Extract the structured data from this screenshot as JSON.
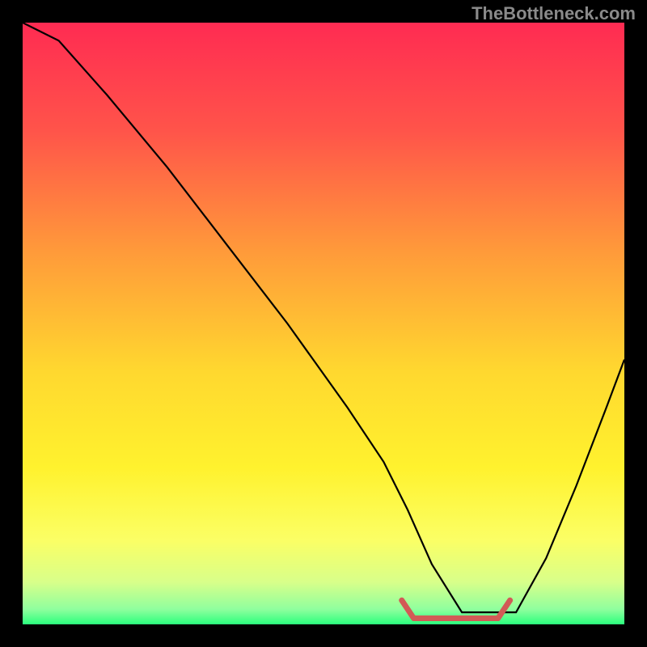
{
  "watermark": "TheBottleneck.com",
  "chart_data": {
    "type": "line",
    "title": "",
    "xlabel": "",
    "ylabel": "",
    "xlim": [
      0,
      100
    ],
    "ylim": [
      0,
      100
    ],
    "background_gradient": {
      "stops": [
        {
          "offset": 0.0,
          "color": "#ff2b52"
        },
        {
          "offset": 0.18,
          "color": "#ff544a"
        },
        {
          "offset": 0.38,
          "color": "#ff9a3a"
        },
        {
          "offset": 0.58,
          "color": "#ffd82f"
        },
        {
          "offset": 0.74,
          "color": "#fff22e"
        },
        {
          "offset": 0.86,
          "color": "#fbff65"
        },
        {
          "offset": 0.93,
          "color": "#d8ff8a"
        },
        {
          "offset": 0.975,
          "color": "#8fff9e"
        },
        {
          "offset": 1.0,
          "color": "#2bff7d"
        }
      ]
    },
    "series": [
      {
        "name": "bottleneck-curve",
        "color": "#000000",
        "width": 2.2,
        "x": [
          0,
          6,
          14,
          24,
          34,
          44,
          54,
          60,
          64,
          68,
          73,
          78,
          82,
          87,
          92,
          97,
          100
        ],
        "y": [
          100,
          97,
          88,
          76,
          63,
          50,
          36,
          27,
          19,
          10,
          2,
          2,
          2,
          11,
          23,
          36,
          44
        ]
      },
      {
        "name": "optimal-zone",
        "color": "#d25a56",
        "width": 7,
        "cap": "round",
        "x": [
          63,
          65,
          72,
          79,
          81
        ],
        "y": [
          4,
          1,
          1,
          1,
          4
        ]
      }
    ],
    "annotations": []
  }
}
